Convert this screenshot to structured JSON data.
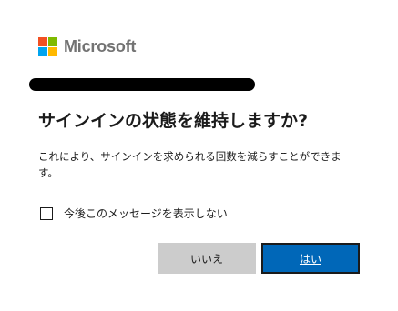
{
  "brand": {
    "name": "Microsoft",
    "logo_colors": [
      "#f25022",
      "#7fba00",
      "#00a4ef",
      "#ffb900"
    ]
  },
  "account": {
    "redacted": true
  },
  "dialog": {
    "title": "サインインの状態を維持しますか?",
    "description": "これにより、サインインを求められる回数を減らすことができます。",
    "checkbox": {
      "label": "今後このメッセージを表示しない",
      "checked": false
    },
    "buttons": {
      "no_label": "いいえ",
      "yes_label": "はい"
    }
  },
  "colors": {
    "primary": "#0067b8",
    "secondary_button": "#cccccc",
    "text": "#1b1b1b",
    "logo_text": "#737373"
  }
}
